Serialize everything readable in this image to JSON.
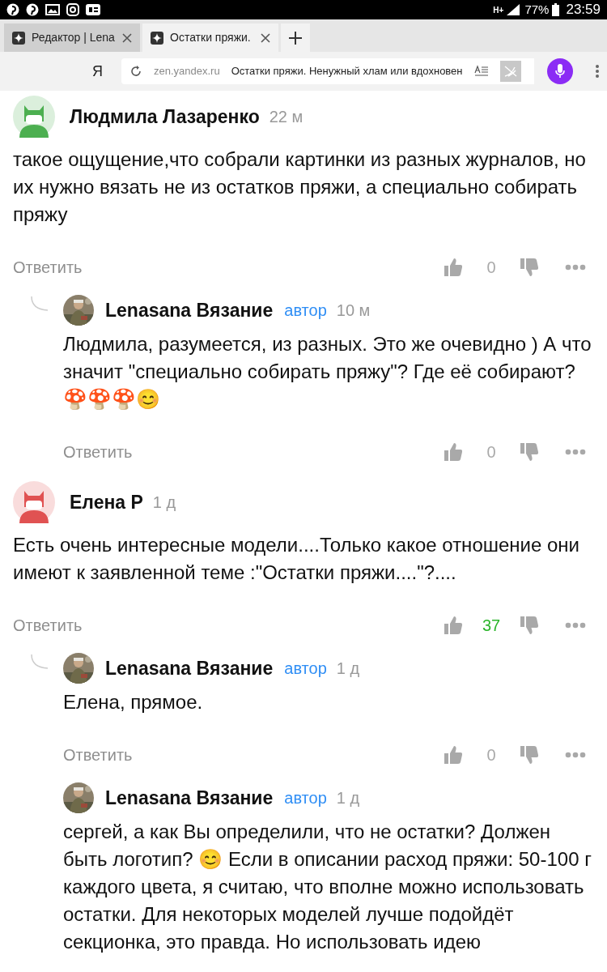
{
  "status_bar": {
    "network": "H+",
    "battery": "77%",
    "time": "23:59"
  },
  "tabs": [
    {
      "title": "Редактор | Lena",
      "selected": false
    },
    {
      "title": "Остатки пряжи.",
      "selected": true
    }
  ],
  "address_bar": {
    "logo": "Я",
    "domain": "zen.yandex.ru",
    "page_title": "Остатки пряжи. Ненужный хлам или вдохновен"
  },
  "comments": [
    {
      "kind": "top",
      "avatar": {
        "kind": "icon",
        "color": "#4caf50"
      },
      "author": "Людмила Лазаренко",
      "time": "22 м",
      "text": "такое ощущение,что собрали картинки из разных журналов, но их нужно вязать не из остатков пряжи, а специально собирать пряжу",
      "reply": "Ответить",
      "likes": "0",
      "positive": false
    },
    {
      "kind": "reply",
      "author": "Lenasana Вязание",
      "badge": "автор",
      "time": "10 м",
      "text": "Людмила, разумеется, из разных. Это же очевидно ) А что значит \"специально собирать пряжу\"? Где её собирают? 🍄🍄🍄😊",
      "reply": "Ответить",
      "likes": "0",
      "positive": false
    },
    {
      "kind": "top",
      "avatar": {
        "kind": "icon",
        "color": "#e05252"
      },
      "author": "Елена Р",
      "time": "1 д",
      "text": "Есть очень интересные модели....Только какое отношение они имеют к заявленной теме :\"Остатки пряжи....\"?....",
      "reply": "Ответить",
      "likes": "37",
      "positive": true
    },
    {
      "kind": "reply",
      "author": "Lenasana Вязание",
      "badge": "автор",
      "time": "1 д",
      "text": "Елена, прямое.",
      "reply": "Ответить",
      "likes": "0",
      "positive": false
    },
    {
      "kind": "nested",
      "author": "Lenasana Вязание",
      "badge": "автор",
      "time": "1 д",
      "text": "сергей, а как Вы определили, что не остатки? Должен быть логотип? 😊 Если в описании расход пряжи: 50-100 г каждого цвета, я считаю, что вполне можно использовать остатки. Для некоторых моделей лучше подойдёт секционка, это правда. Но использовать идею"
    }
  ]
}
